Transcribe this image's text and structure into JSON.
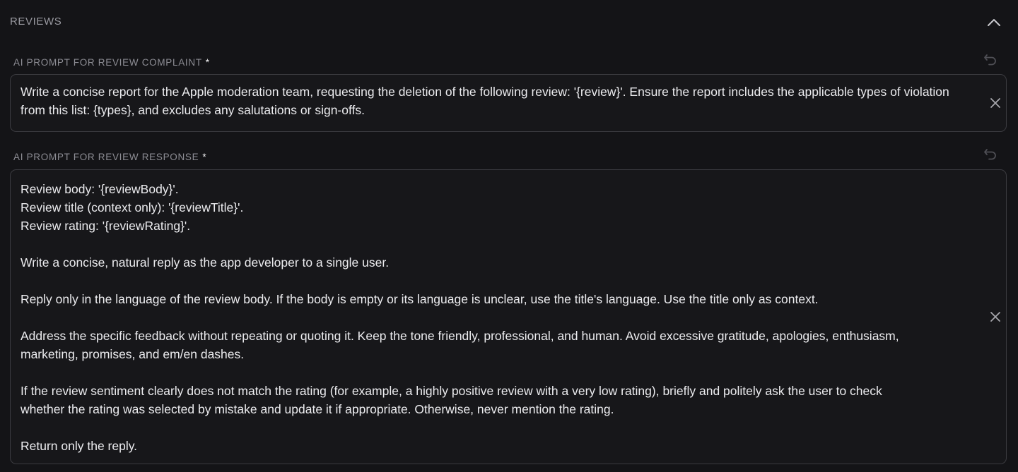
{
  "section": {
    "title": "REVIEWS",
    "collapse_icon": "chevron-up-icon"
  },
  "fields": [
    {
      "label": "AI PROMPT FOR REVIEW COMPLAINT",
      "required_mark": "*",
      "reset_icon": "undo-icon",
      "clear_icon": "close-icon",
      "value": "Write a concise report for the Apple moderation team, requesting the deletion of the following review: '{review}'. Ensure the report includes the applicable types of violation from this list: {types}, and excludes any salutations or sign-offs."
    },
    {
      "label": "AI PROMPT FOR REVIEW RESPONSE",
      "required_mark": "*",
      "reset_icon": "undo-icon",
      "clear_icon": "close-icon",
      "value": "Review body: '{reviewBody}'.\nReview title (context only): '{reviewTitle}'.\nReview rating: '{reviewRating}'.\n\nWrite a concise, natural reply as the app developer to a single user.\n\nReply only in the language of the review body. If the body is empty or its language is unclear, use the title's language. Use the title only as context.\n\nAddress the specific feedback without repeating or quoting it. Keep the tone friendly, professional, and human. Avoid excessive gratitude, apologies, enthusiasm,\nmarketing, promises, and em/en dashes.\n\nIf the review sentiment clearly does not match the rating (for example, a highly positive review with a very low rating), briefly and politely ask the user to check\nwhether the rating was selected by mistake and update it if appropriate. Otherwise, never mention the rating.\n\nReturn only the reply."
    }
  ]
}
